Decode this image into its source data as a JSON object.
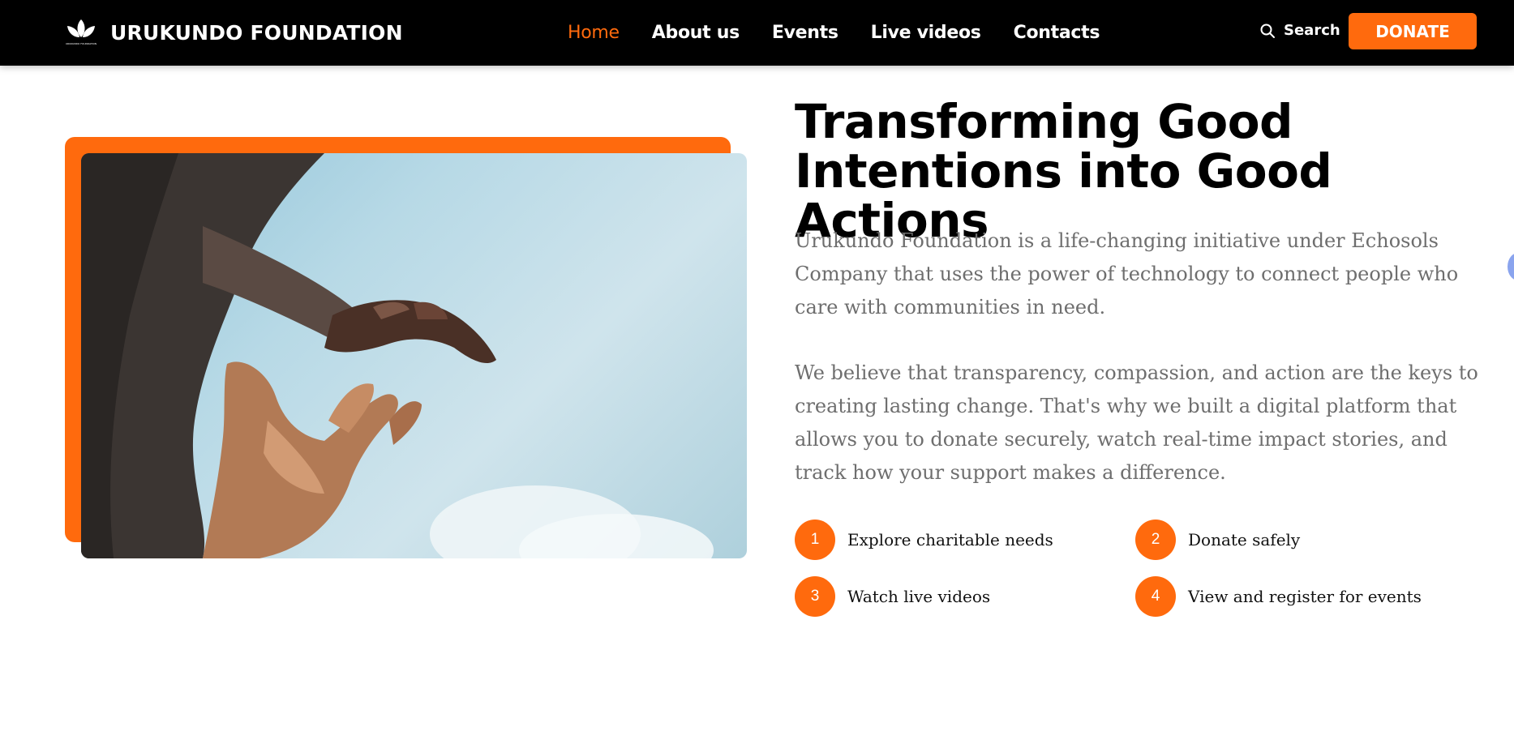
{
  "brand": {
    "logo_icon": "leaf-logo-icon",
    "logo_caption": "URUKUNDO FOUNDATION",
    "name": "URUKUNDO FOUNDATION"
  },
  "nav": {
    "items": [
      {
        "label": "Home",
        "active": true
      },
      {
        "label": "About us",
        "active": false
      },
      {
        "label": "Events",
        "active": false
      },
      {
        "label": "Live videos",
        "active": false
      },
      {
        "label": "Contacts",
        "active": false
      }
    ],
    "search_label": "Search",
    "search_icon": "search-icon",
    "donate_label": "DONATE"
  },
  "hero": {
    "image_subject": "reaching-hands-against-sky",
    "headline": "Transforming Good Intentions into Good Actions",
    "paragraph_1": "Urukundo Foundation is a life-changing initiative under Echosols Company that uses the power of technology to connect people who care with communities in need.",
    "paragraph_2": "We believe that transparency, compassion, and action are the keys to creating lasting change. That's why we built a digital platform that allows you to donate securely, watch real-time impact stories, and track how your support makes a difference.",
    "steps": [
      {
        "number": "1",
        "label": "Explore charitable needs"
      },
      {
        "number": "2",
        "label": "Donate safely"
      },
      {
        "number": "3",
        "label": "Watch live videos"
      },
      {
        "number": "4",
        "label": "View and register for events"
      }
    ]
  },
  "colors": {
    "accent": "#ff6a0d",
    "navbar_bg": "#000000",
    "heading": "#000000",
    "body_text": "#6e6e6e"
  }
}
